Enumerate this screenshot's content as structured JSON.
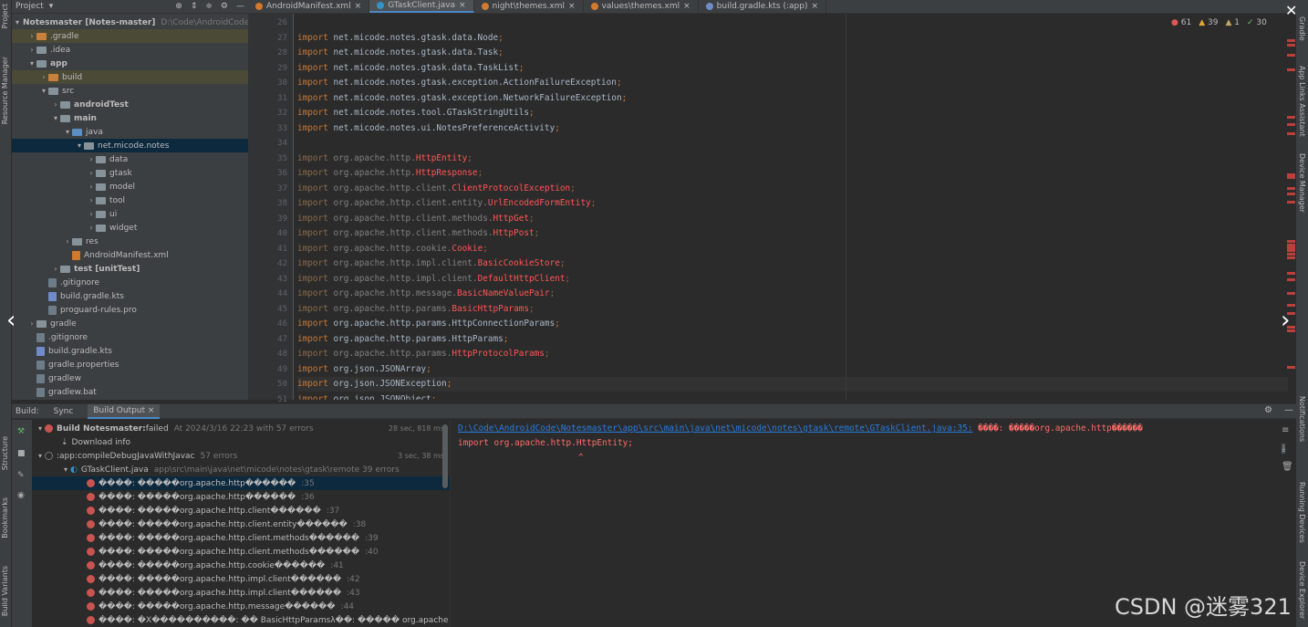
{
  "left_strip": {
    "project": "Project",
    "resource_manager": "Resource Manager",
    "structure": "Structure",
    "bookmarks": "Bookmarks",
    "build_variants": "Build Variants"
  },
  "right_strip": {
    "gradle": "Gradle",
    "app_links": "App Links Assistant",
    "device_manager": "Device Manager",
    "notifications": "Notifications",
    "running_devices": "Running Devices",
    "device_explorer": "Device Explorer"
  },
  "project_panel": {
    "title": "Project",
    "tree": [
      {
        "label": "Notesmaster [Notes-master]",
        "suffix": "D:\\Code\\AndroidCode",
        "bold": true
      },
      {
        "label": ".gradle"
      },
      {
        "label": ".idea"
      },
      {
        "label": "app",
        "bold": true
      },
      {
        "label": "build"
      },
      {
        "label": "src"
      },
      {
        "label": "androidTest",
        "bold": true
      },
      {
        "label": "main",
        "bold": true
      },
      {
        "label": "java"
      },
      {
        "label": "net.micode.notes"
      },
      {
        "label": "data"
      },
      {
        "label": "gtask"
      },
      {
        "label": "model"
      },
      {
        "label": "tool"
      },
      {
        "label": "ui"
      },
      {
        "label": "widget"
      },
      {
        "label": "res"
      },
      {
        "label": "AndroidManifest.xml"
      },
      {
        "label": "test [unitTest]",
        "bold": true
      },
      {
        "label": ".gitignore"
      },
      {
        "label": "build.gradle.kts"
      },
      {
        "label": "proguard-rules.pro"
      },
      {
        "label": "gradle"
      },
      {
        "label": ".gitignore"
      },
      {
        "label": "build.gradle.kts"
      },
      {
        "label": "gradle.properties"
      },
      {
        "label": "gradlew"
      },
      {
        "label": "gradlew.bat"
      }
    ]
  },
  "editor": {
    "tabs": [
      {
        "label": "AndroidManifest.xml"
      },
      {
        "label": "GTaskClient.java"
      },
      {
        "label": "night\\themes.xml"
      },
      {
        "label": "values\\themes.xml"
      },
      {
        "label": "build.gradle.kts (:app)"
      }
    ],
    "counts": {
      "errors": "61",
      "warnings": "39",
      "weak": "1",
      "typos": "30"
    },
    "lines": [
      {
        "n": "26",
        "pre": "",
        "imp": "",
        "pkg": "",
        "cls": ""
      },
      {
        "n": "27",
        "imp": "import",
        "pkg": " net.micode.notes.gtask.data.Node",
        "cls": ""
      },
      {
        "n": "28",
        "imp": "import",
        "pkg": " net.micode.notes.gtask.data.Task",
        "cls": ""
      },
      {
        "n": "29",
        "imp": "import",
        "pkg": " net.micode.notes.gtask.data.TaskList",
        "cls": ""
      },
      {
        "n": "30",
        "imp": "import",
        "pkg": " net.micode.notes.gtask.exception.ActionFailureException",
        "cls": ""
      },
      {
        "n": "31",
        "imp": "import",
        "pkg": " net.micode.notes.gtask.exception.NetworkFailureException",
        "cls": ""
      },
      {
        "n": "32",
        "imp": "import",
        "pkg": " net.micode.notes.tool.GTaskStringUtils",
        "cls": ""
      },
      {
        "n": "33",
        "imp": "import",
        "pkg": " net.micode.notes.ui.NotesPreferenceActivity",
        "cls": ""
      },
      {
        "n": "34",
        "imp": "",
        "pkg": "",
        "cls": ""
      },
      {
        "n": "35",
        "imp": "import",
        "pkg": " org.apache.http.",
        "cls": "HttpEntity",
        "dim": true
      },
      {
        "n": "36",
        "imp": "import",
        "pkg": " org.apache.http.",
        "cls": "HttpResponse",
        "dim": true
      },
      {
        "n": "37",
        "imp": "import",
        "pkg": " org.apache.http.client.",
        "cls": "ClientProtocolException",
        "dim": true
      },
      {
        "n": "38",
        "imp": "import",
        "pkg": " org.apache.http.client.entity.",
        "cls": "UrlEncodedFormEntity",
        "dim": true
      },
      {
        "n": "39",
        "imp": "import",
        "pkg": " org.apache.http.client.methods.",
        "cls": "HttpGet",
        "dim": true
      },
      {
        "n": "40",
        "imp": "import",
        "pkg": " org.apache.http.client.methods.",
        "cls": "HttpPost",
        "dim": true
      },
      {
        "n": "41",
        "imp": "import",
        "pkg": " org.apache.http.cookie.",
        "cls": "Cookie",
        "dim": true
      },
      {
        "n": "42",
        "imp": "import",
        "pkg": " org.apache.http.impl.client.",
        "cls": "BasicCookieStore",
        "dim": true
      },
      {
        "n": "43",
        "imp": "import",
        "pkg": " org.apache.http.impl.client.",
        "cls": "DefaultHttpClient",
        "dim": true
      },
      {
        "n": "44",
        "imp": "import",
        "pkg": " org.apache.http.message.",
        "cls": "BasicNameValuePair",
        "dim": true
      },
      {
        "n": "45",
        "imp": "import",
        "pkg": " org.apache.http.params.",
        "cls": "BasicHttpParams",
        "dim": true
      },
      {
        "n": "46",
        "imp": "import",
        "pkg": " org.apache.http.params.HttpConnectionParams",
        "cls": ""
      },
      {
        "n": "47",
        "imp": "import",
        "pkg": " org.apache.http.params.HttpParams",
        "cls": ""
      },
      {
        "n": "48",
        "imp": "import",
        "pkg": " org.apache.http.params.",
        "cls": "HttpProtocolParams",
        "dim": true
      },
      {
        "n": "49",
        "imp": "import",
        "pkg": " org.json.JSONArray",
        "cls": ""
      },
      {
        "n": "50",
        "imp": "import",
        "pkg": " org.json.JSONException",
        "cls": "",
        "current": true
      },
      {
        "n": "51",
        "imp": "import",
        "pkg": " org.json.JSONObject",
        "cls": ""
      }
    ]
  },
  "build": {
    "label": "Build:",
    "tabs": [
      {
        "label": "Sync"
      },
      {
        "label": "Build Output"
      }
    ],
    "rows": [
      {
        "text": "Build Notesmaster:",
        "status": "failed",
        "extra": "At 2024/3/16 22:23 with 57 errors",
        "time": "28 sec, 818 ms"
      },
      {
        "text": "Download info"
      },
      {
        "text": ":app:compileDebugJavaWithJavac",
        "extra": "57 errors",
        "time": "3 sec, 38 ms"
      },
      {
        "text": "GTaskClient.java",
        "extra": "app\\src\\main\\java\\net\\micode\\notes\\gtask\\remote 39 errors"
      },
      {
        "text": "����: �����org.apache.http������",
        "line": ":35"
      },
      {
        "text": "����: �����org.apache.http������",
        "line": ":36"
      },
      {
        "text": "����: �����org.apache.http.client������",
        "line": ":37"
      },
      {
        "text": "����: �����org.apache.http.client.entity������",
        "line": ":38"
      },
      {
        "text": "����: �����org.apache.http.client.methods������",
        "line": ":39"
      },
      {
        "text": "����: �����org.apache.http.client.methods������",
        "line": ":40"
      },
      {
        "text": "����: �����org.apache.http.cookie������",
        "line": ":41"
      },
      {
        "text": "����: �����org.apache.http.impl.client������",
        "line": ":42"
      },
      {
        "text": "����: �����org.apache.http.impl.client������",
        "line": ":43"
      },
      {
        "text": "����: �����org.apache.http.message������",
        "line": ":44"
      },
      {
        "text": "����: �X����������:   �� BasicHttpParamsλ��: ����� org.apache",
        "line": ""
      }
    ],
    "output": {
      "path": "D:\\Code\\AndroidCode\\Notesmaster\\app\\src\\main\\java\\net\\micode\\notes\\gtask\\remote\\GTaskClient.java:35:",
      "message": " ����: �����org.apache.http������",
      "code": "import org.apache.http.HttpEntity;",
      "caret": "^"
    }
  },
  "watermark": "CSDN @迷雾321"
}
